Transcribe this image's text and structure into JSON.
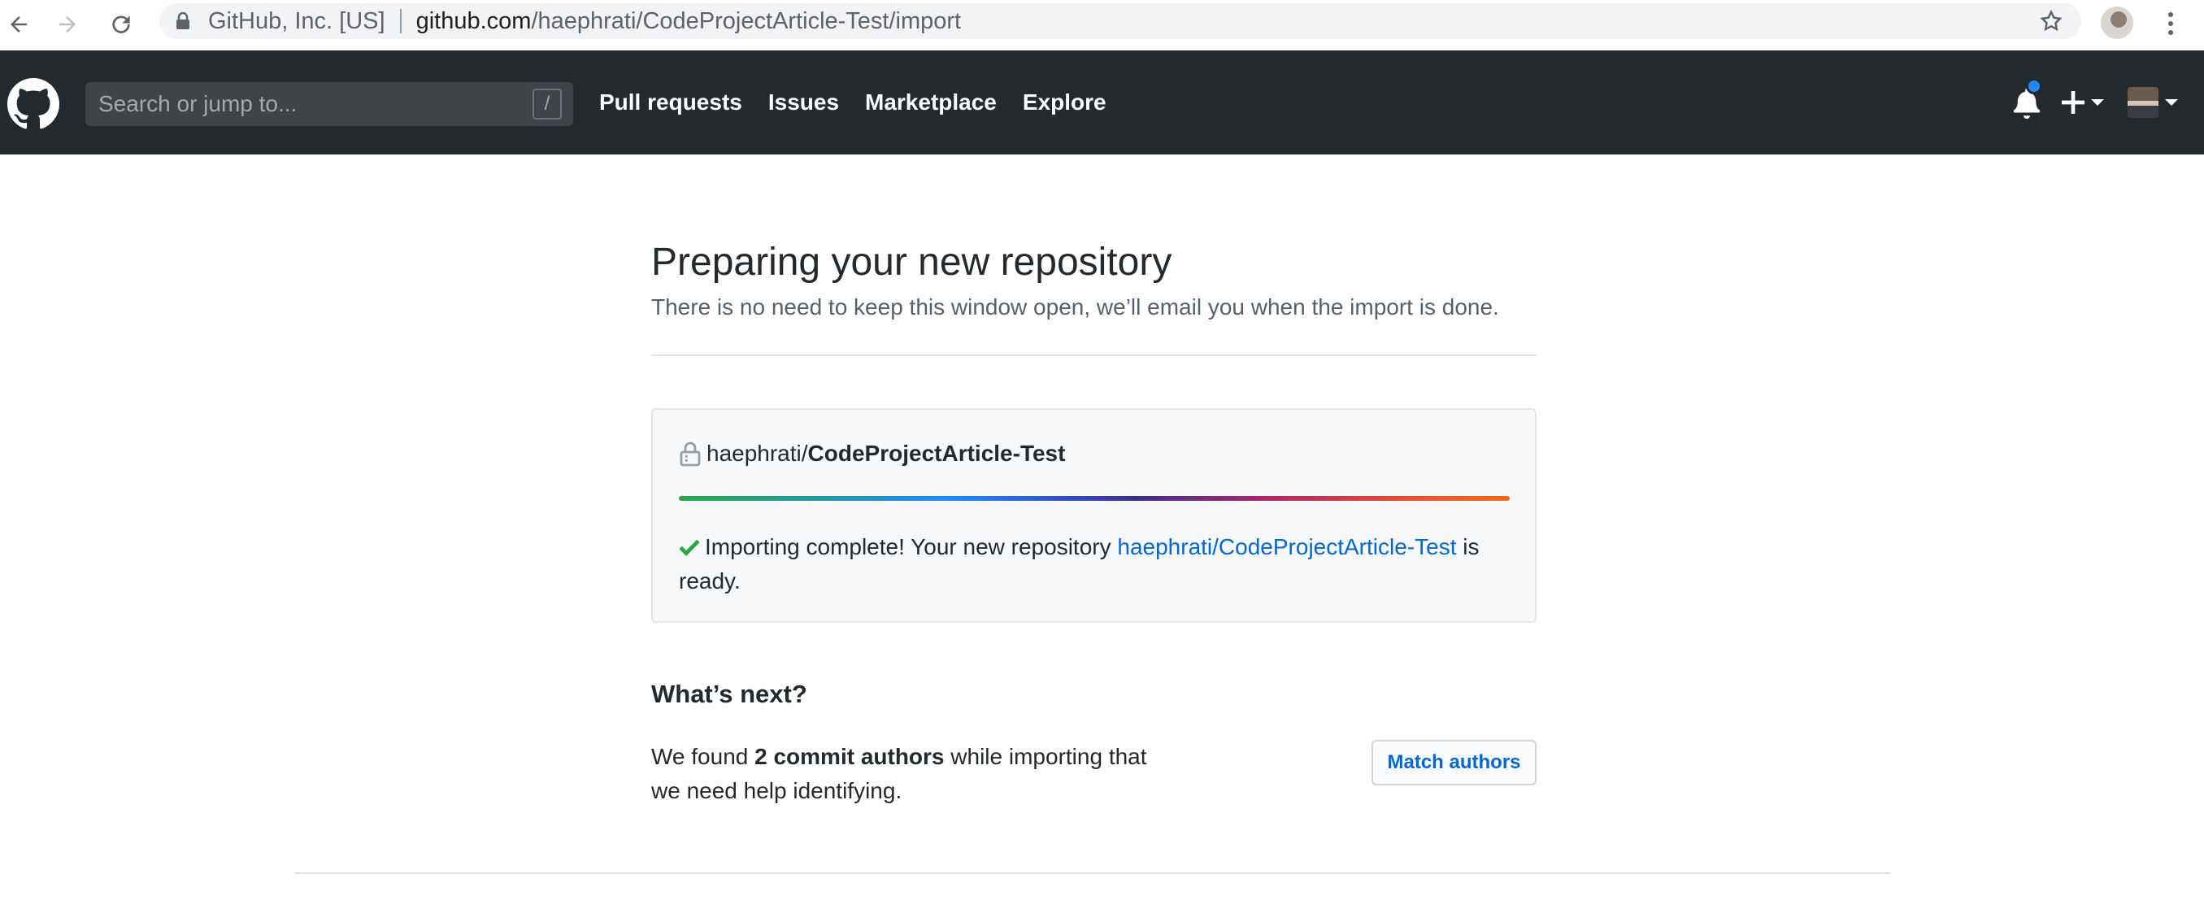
{
  "browser": {
    "site_identity": "GitHub, Inc. [US]",
    "url_host": "github.com",
    "url_path": "/haephrati/CodeProjectArticle-Test/import"
  },
  "header": {
    "search_placeholder": "Search or jump to...",
    "search_shortcut": "/",
    "nav": [
      "Pull requests",
      "Issues",
      "Marketplace",
      "Explore"
    ],
    "notification_dot_color": "#2188ff"
  },
  "main": {
    "title": "Preparing your new repository",
    "subtitle": "There is no need to keep this window open, we’ll email you when the import is done.",
    "import": {
      "repo_owner": "haephrati/",
      "repo_name": "CodeProjectArticle-Test",
      "progress_fraction": 1.0,
      "status_prefix": "Importing complete! Your new repository ",
      "status_link": "haephrati/CodeProjectArticle-Test",
      "status_suffix": " is ready."
    },
    "next": {
      "heading": "What’s next?",
      "text_prefix": "We found ",
      "text_bold": "2 commit authors",
      "text_suffix": " while importing that we need help identifying.",
      "button_label": "Match authors"
    }
  },
  "colors": {
    "header_bg": "#24292e",
    "link": "#0366d6",
    "success": "#28a745"
  }
}
